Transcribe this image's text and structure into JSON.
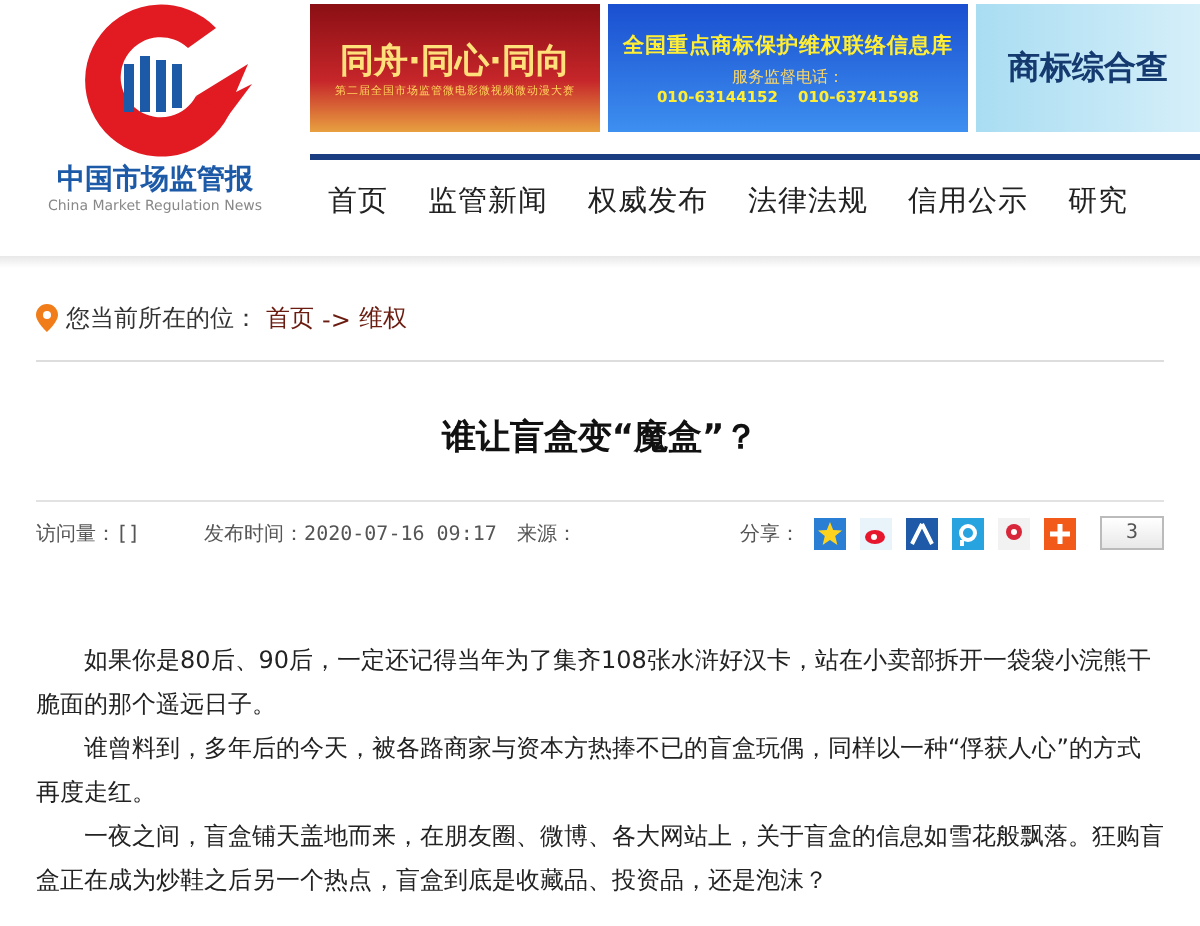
{
  "logo": {
    "name": "中国市场监管报",
    "subtitle": "China Market Regulation News"
  },
  "banners": [
    {
      "kind": "red",
      "headline": "同舟·同心·同向",
      "subline": "第二届全国市场监管微电影微视频微动漫大赛"
    },
    {
      "kind": "blue",
      "headline": "全国重点商标保护维权联络信息库",
      "subline": "服务监督电话：",
      "phones": [
        "010-63144152",
        "010-63741598"
      ]
    },
    {
      "kind": "light",
      "headline": "商标综合查"
    }
  ],
  "nav": [
    {
      "label": "首页"
    },
    {
      "label": "监管新闻"
    },
    {
      "label": "权威发布"
    },
    {
      "label": "法律法规"
    },
    {
      "label": "信用公示"
    },
    {
      "label": "研究"
    }
  ],
  "breadcrumb": {
    "prefix": "您当前所在的位：",
    "links": [
      "首页",
      "维权"
    ],
    "separator": "->"
  },
  "article": {
    "title": "谁让盲盒变“魔盒”？",
    "meta": {
      "visits": "访问量：[]",
      "published": "发布时间：2020-07-16 09:17",
      "source": "来源："
    },
    "share": {
      "label": "分享：",
      "services": [
        {
          "kind": "qzone"
        },
        {
          "kind": "weibo"
        },
        {
          "kind": "renren"
        },
        {
          "kind": "pengyou"
        },
        {
          "kind": "tqq"
        },
        {
          "kind": "more"
        }
      ],
      "count": "3"
    },
    "paragraphs": [
      "如果你是80后、90后，一定还记得当年为了集齐108张水浒好汉卡，站在小卖部拆开一袋袋小浣熊干脆面的那个遥远日子。",
      "谁曾料到，多年后的今天，被各路商家与资本方热捧不已的盲盒玩偶，同样以一种“俘获人心”的方式再度走红。",
      "一夜之间，盲盒铺天盖地而来，在朋友圈、微博、各大网站上，关于盲盒的信息如雪花般飘落。狂购盲盒正在成为炒鞋之后另一个热点，盲盒到底是收藏品、投资品，还是泡沫？"
    ]
  }
}
